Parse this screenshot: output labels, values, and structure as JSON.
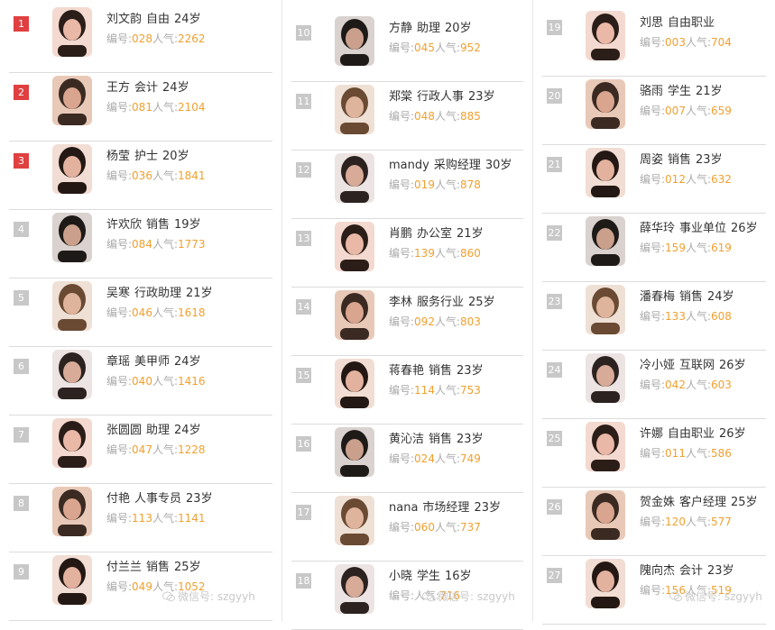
{
  "list_labels": {
    "id_label": "编号:",
    "popularity_label": "人气:"
  },
  "colors": {
    "top_rank_bg": "#e04040",
    "rank_bg": "#c8c8c8",
    "number_color": "#f0a030"
  },
  "watermark": "微信号: szgyyh",
  "columns": [
    {
      "rows": [
        {
          "rank": "1",
          "name": "刘文韵",
          "job": "自由",
          "age": "24岁",
          "id": "028",
          "pop": "2262"
        },
        {
          "rank": "2",
          "name": "王方",
          "job": "会计",
          "age": "24岁",
          "id": "081",
          "pop": "2104"
        },
        {
          "rank": "3",
          "name": "杨莹",
          "job": "护士",
          "age": "20岁",
          "id": "036",
          "pop": "1841"
        },
        {
          "rank": "4",
          "name": "许欢欣",
          "job": "销售",
          "age": "19岁",
          "id": "084",
          "pop": "1773"
        },
        {
          "rank": "5",
          "name": "吴寒",
          "job": "行政助理",
          "age": "21岁",
          "id": "046",
          "pop": "1618"
        },
        {
          "rank": "6",
          "name": "章瑶",
          "job": "美甲师",
          "age": "24岁",
          "id": "040",
          "pop": "1416"
        },
        {
          "rank": "7",
          "name": "张圆圆",
          "job": "助理",
          "age": "24岁",
          "id": "047",
          "pop": "1228"
        },
        {
          "rank": "8",
          "name": "付艳",
          "job": "人事专员",
          "age": "23岁",
          "id": "113",
          "pop": "1141"
        },
        {
          "rank": "9",
          "name": "付兰兰",
          "job": "销售",
          "age": "25岁",
          "id": "049",
          "pop": "1052"
        }
      ]
    },
    {
      "rows": [
        {
          "rank": "10",
          "name": "方静",
          "job": "助理",
          "age": "20岁",
          "id": "045",
          "pop": "952"
        },
        {
          "rank": "11",
          "name": "郑棠",
          "job": "行政人事",
          "age": "23岁",
          "id": "048",
          "pop": "885"
        },
        {
          "rank": "12",
          "name": "mandy",
          "job": "采购经理",
          "age": "30岁",
          "id": "019",
          "pop": "878"
        },
        {
          "rank": "13",
          "name": "肖鹏",
          "job": "办公室",
          "age": "21岁",
          "id": "139",
          "pop": "860"
        },
        {
          "rank": "14",
          "name": "李林",
          "job": "服务行业",
          "age": "25岁",
          "id": "092",
          "pop": "803"
        },
        {
          "rank": "15",
          "name": "蒋春艳",
          "job": "销售",
          "age": "23岁",
          "id": "114",
          "pop": "753"
        },
        {
          "rank": "16",
          "name": "黄沁洁",
          "job": "销售",
          "age": "23岁",
          "id": "024",
          "pop": "749"
        },
        {
          "rank": "17",
          "name": "nana",
          "job": "市场经理",
          "age": "23岁",
          "id": "060",
          "pop": "737"
        },
        {
          "rank": "18",
          "name": "小晓",
          "job": "学生",
          "age": "16岁",
          "id": "",
          "pop": "716"
        }
      ]
    },
    {
      "rows": [
        {
          "rank": "19",
          "name": "刘思",
          "job": "自由职业",
          "age": "",
          "id": "003",
          "pop": "704"
        },
        {
          "rank": "20",
          "name": "骆雨",
          "job": "学生",
          "age": "21岁",
          "id": "007",
          "pop": "659"
        },
        {
          "rank": "21",
          "name": "周姿",
          "job": "销售",
          "age": "23岁",
          "id": "012",
          "pop": "632"
        },
        {
          "rank": "22",
          "name": "薛华玲",
          "job": "事业单位",
          "age": "26岁",
          "id": "159",
          "pop": "619"
        },
        {
          "rank": "23",
          "name": "潘春梅",
          "job": "销售",
          "age": "24岁",
          "id": "133",
          "pop": "608"
        },
        {
          "rank": "24",
          "name": "冷小娅",
          "job": "互联网",
          "age": "26岁",
          "id": "042",
          "pop": "603"
        },
        {
          "rank": "25",
          "name": "许娜",
          "job": "自由职业",
          "age": "26岁",
          "id": "011",
          "pop": "586"
        },
        {
          "rank": "26",
          "name": "贺金姝",
          "job": "客户经理",
          "age": "25岁",
          "id": "120",
          "pop": "577"
        },
        {
          "rank": "27",
          "name": "隗向杰",
          "job": "会计",
          "age": "23岁",
          "id": "156",
          "pop": "519"
        }
      ]
    }
  ]
}
